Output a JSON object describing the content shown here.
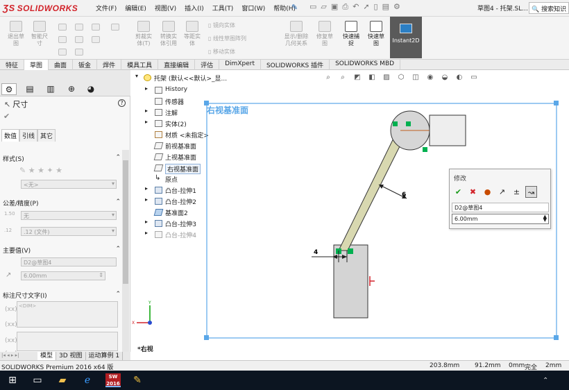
{
  "app": {
    "brand": "SOLIDWORKS",
    "menu": [
      "文件(F)",
      "编辑(E)",
      "视图(V)",
      "插入(I)",
      "工具(T)",
      "窗口(W)",
      "帮助(H)"
    ],
    "document_title": "草图4 - 托架.SL...",
    "search_placeholder": "搜索知识"
  },
  "ribbon": {
    "items": [
      {
        "label": "退出草\n图",
        "active": false
      },
      {
        "label": "智能尺\n寸",
        "active": false
      },
      {
        "label": "剪裁实\n体(T)",
        "active": false
      },
      {
        "label": "转换实\n体引用",
        "active": false
      },
      {
        "label": "等距实\n体",
        "active": false
      },
      {
        "label": "显示/删除\n几何关系",
        "active": false
      },
      {
        "label": "修复草\n图",
        "active": false
      },
      {
        "label": "快速捕\n捉",
        "active": true
      },
      {
        "label": "快速草\n图",
        "active": true
      },
      {
        "label": "Instant2D",
        "active": true
      }
    ],
    "mirror": "镜向实体",
    "pattern": "线性草图阵列",
    "move": "移动实体"
  },
  "command_tabs": [
    "特征",
    "草图",
    "曲面",
    "钣金",
    "焊件",
    "模具工具",
    "直接编辑",
    "评估",
    "DimXpert",
    "SOLIDWORKS 插件",
    "SOLIDWORKS MBD"
  ],
  "command_tab_active": "草图",
  "property_manager": {
    "title": "尺寸",
    "subtabs": [
      "数值",
      "引线",
      "其它"
    ],
    "style_label": "样式(S)",
    "style_value": "<无>",
    "tolerance_label": "公差/精度(P)",
    "tolerance_value": "无",
    "precision_value": ".12 (文件)",
    "primary_label": "主要值(V)",
    "primary_name": "D2@草图4",
    "primary_value": "6.00mm",
    "dim_text_label": "标注尺寸文字(I)",
    "dim_text_value": "<DIM>"
  },
  "tree": {
    "root": "托架 (默认<<默认>_显...",
    "items": [
      {
        "label": "History",
        "dim": false,
        "arrow": true
      },
      {
        "label": "传感器",
        "dim": false,
        "arrow": false
      },
      {
        "label": "注解",
        "dim": false,
        "arrow": true
      },
      {
        "label": "实体(2)",
        "dim": false,
        "arrow": true
      },
      {
        "label": "材质 <未指定>",
        "dim": false,
        "arrow": false
      },
      {
        "label": "前视基准面",
        "dim": false,
        "arrow": false
      },
      {
        "label": "上视基准面",
        "dim": false,
        "arrow": false
      },
      {
        "label": "右视基准面",
        "dim": false,
        "arrow": false,
        "selected": true
      },
      {
        "label": "原点",
        "dim": false,
        "arrow": false
      },
      {
        "label": "凸台-拉伸1",
        "dim": false,
        "arrow": true
      },
      {
        "label": "凸台-拉伸2",
        "dim": false,
        "arrow": true
      },
      {
        "label": "基准面2",
        "dim": false,
        "arrow": false
      },
      {
        "label": "凸台-拉伸3",
        "dim": false,
        "arrow": true
      },
      {
        "label": "凸台-拉伸4",
        "dim": true,
        "arrow": true
      }
    ]
  },
  "graphics": {
    "plane_label": "右视基准面",
    "view_label": "*右视",
    "dim_top": "6",
    "dim_bottom": "4"
  },
  "modify_dialog": {
    "title": "修改",
    "dimension_name": "D2@草图4",
    "value": "6.00mm"
  },
  "bottom_tabs": [
    "模型",
    "3D 视图",
    "运动算例 1"
  ],
  "bottom_tab_active": "模型",
  "status": {
    "product": "SOLIDWORKS Premium 2016 x64 版",
    "x": "203.8mm",
    "y": "91.2mm",
    "z": "0mm",
    "state": "完全",
    "extra": "2mm"
  },
  "taskbar": {
    "sw_label": "SW\n2016"
  },
  "colors": {
    "accent_red": "#d2232a",
    "plane_blue": "#5aa7e8",
    "sketch_green": "#00b050",
    "arm_fill": "#d8d8b0"
  }
}
